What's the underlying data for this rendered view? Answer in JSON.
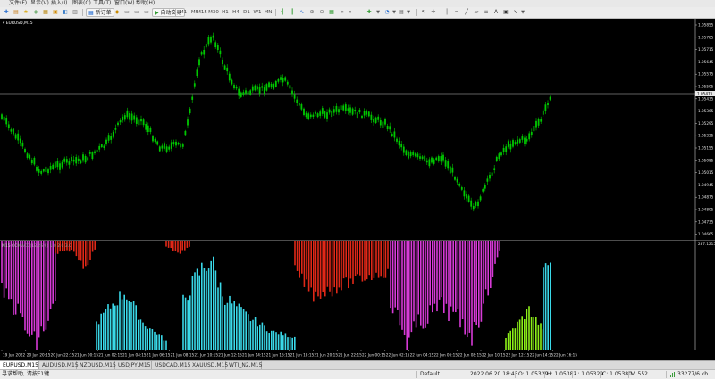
{
  "menu": [
    "文件(F)",
    "显示(V)",
    "插入(I)",
    "图表(C)",
    "工具(T)",
    "窗口(W)",
    "帮助(H)"
  ],
  "toolbar": {
    "new_order_label": "新订单",
    "auto_trading_label": "自动交易",
    "timeframes": [
      "M1",
      "M5",
      "M15",
      "M30",
      "H1",
      "H4",
      "D1",
      "W1",
      "MN"
    ]
  },
  "main_chart": {
    "title": "EURUSD,M15",
    "price_labels": [
      "1.05855",
      "1.05785",
      "1.05715",
      "1.05645",
      "1.05575",
      "1.05505",
      "1.05435",
      "1.05365",
      "1.05295",
      "1.05225",
      "1.05155",
      "1.05085",
      "1.05015",
      "1.04945",
      "1.04875",
      "1.04805",
      "1.04735",
      "1.04665"
    ],
    "current_price_label": "1.05476",
    "candle_color": "#00c800",
    "price_line_color": "#c0c0c0"
  },
  "indicator": {
    "title": "M15 CCI",
    "legend": "MACD(12,26,9) 1.0 2.0 3.0",
    "axis_labels": [
      "287.1215"
    ],
    "colors": {
      "magenta": "#d63ad6",
      "cyan": "#3ad8e8",
      "red": "#e02818",
      "green": "#8cf018"
    }
  },
  "time_axis": [
    "19 Jun 2022",
    "20 Jun 20:15",
    "20 Jun 22:15",
    "21 Jun 00:15",
    "21 Jun 02:15",
    "21 Jun 04:15",
    "21 Jun 06:15",
    "21 Jun 08:15",
    "21 Jun 10:15",
    "21 Jun 12:15",
    "21 Jun 14:15",
    "21 Jun 16:15",
    "21 Jun 18:15",
    "21 Jun 20:15",
    "21 Jun 22:15",
    "22 Jun 00:15",
    "22 Jun 02:15",
    "22 Jun 04:15",
    "22 Jun 06:15",
    "22 Jun 08:15",
    "22 Jun 10:15",
    "22 Jun 12:15",
    "22 Jun 14:15",
    "22 Jun 16:15"
  ],
  "tabs": [
    "EURUSD,M15",
    "AUDUSD,M15",
    "NZDUSD,M15",
    "USDJPY,M15",
    "USDCAD,M15",
    "XAUUSD,M15",
    "WTI_N2,M15"
  ],
  "status": {
    "help": "寻求帮助, 请按F1键",
    "profile": "Default",
    "datetime": "2022.06.20 18:45",
    "open": "O: 1.05329",
    "high": "H: 1.05382",
    "low": "L: 1.05329",
    "close": "C: 1.05380",
    "volume": "V: 552",
    "traffic": "33277/6 kb"
  }
}
